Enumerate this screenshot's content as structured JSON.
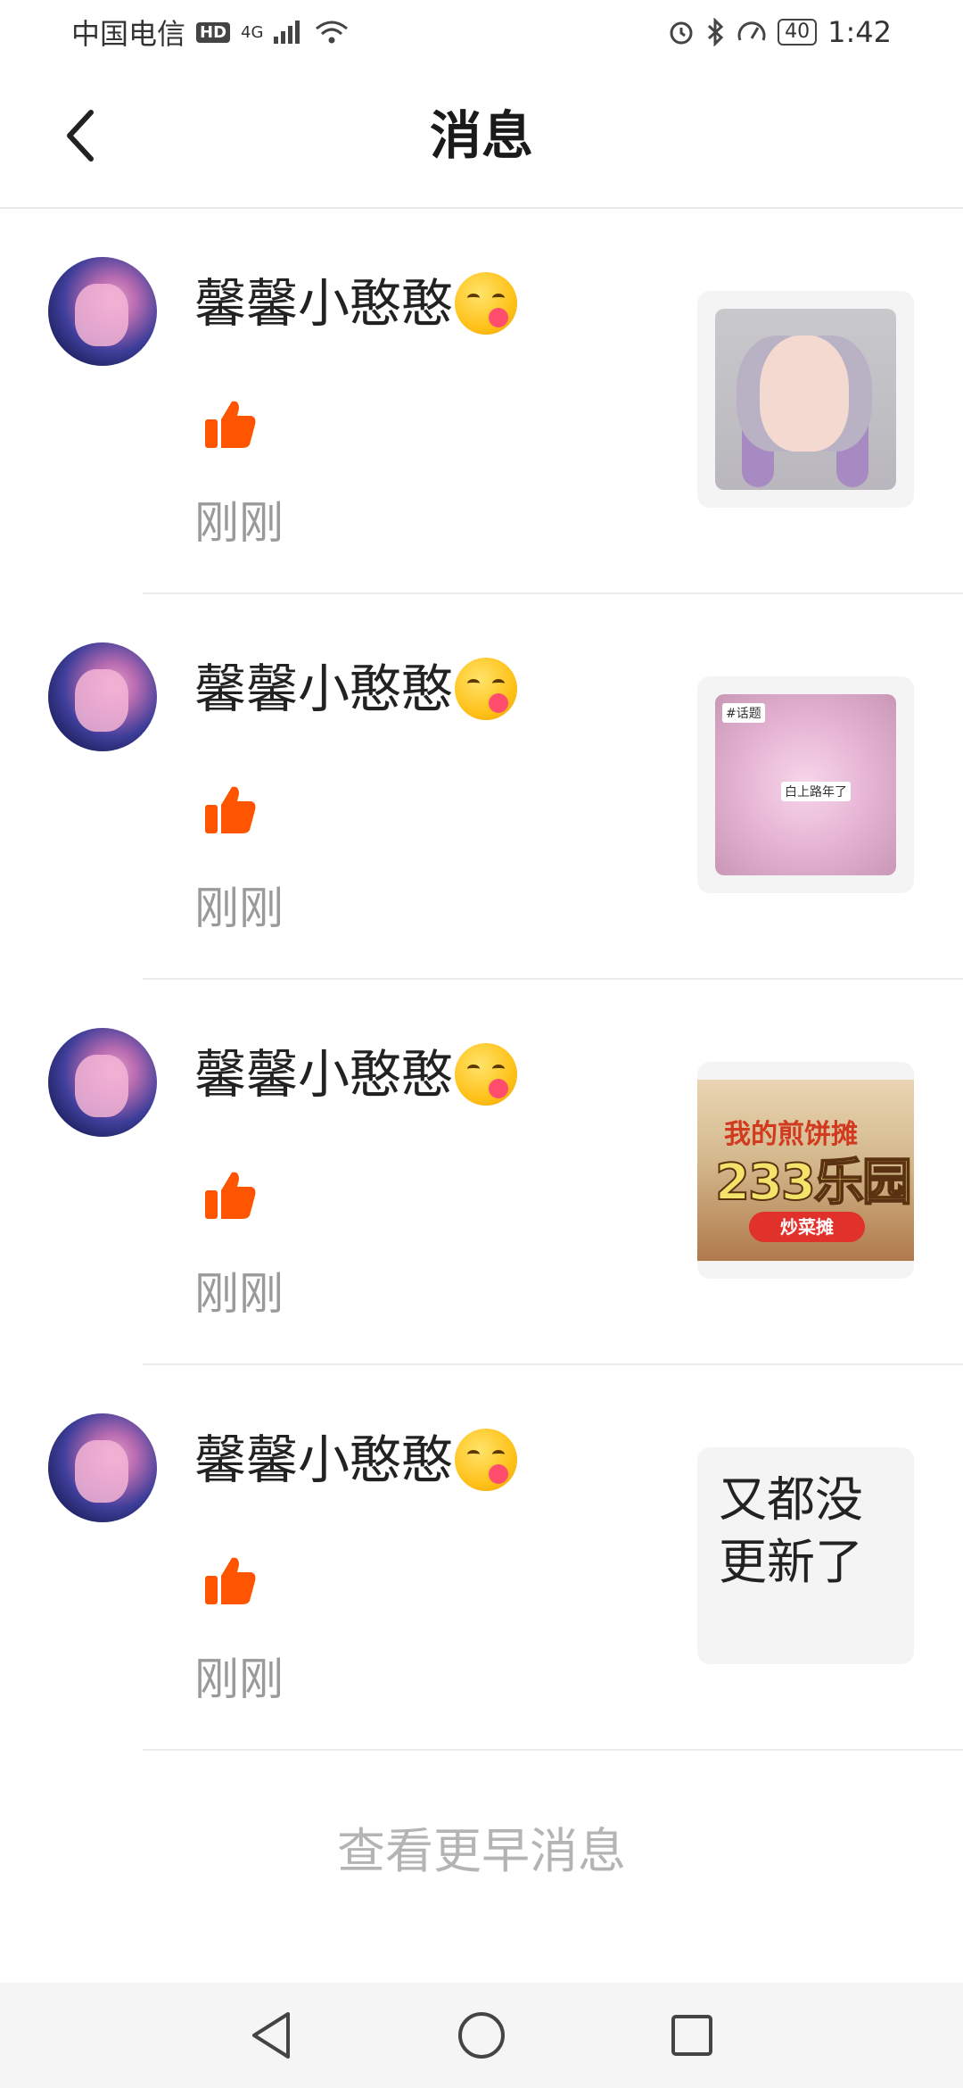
{
  "status_bar": {
    "carrier": "中国电信",
    "hd": "HD",
    "network": "4G",
    "battery": "40",
    "time": "1:42"
  },
  "header": {
    "title": "消息",
    "back_icon": "chevron-left-icon"
  },
  "notifications": [
    {
      "username": "馨馨小憨憨",
      "emoji": "yum-face-emoji",
      "action_icon": "thumbs-up-icon",
      "time": "刚刚",
      "thumbnail": {
        "kind": "image",
        "description_icon": "anime-character-image"
      }
    },
    {
      "username": "馨馨小憨憨",
      "emoji": "yum-face-emoji",
      "action_icon": "thumbs-up-icon",
      "time": "刚刚",
      "thumbnail": {
        "kind": "image",
        "tag": "#话题",
        "caption": "白上路年了"
      }
    },
    {
      "username": "馨馨小憨憨",
      "emoji": "yum-face-emoji",
      "action_icon": "thumbs-up-icon",
      "time": "刚刚",
      "thumbnail": {
        "kind": "image",
        "title": "我的煎饼摊",
        "big": "233乐园",
        "button": "炒菜摊"
      }
    },
    {
      "username": "馨馨小憨憨",
      "emoji": "yum-face-emoji",
      "action_icon": "thumbs-up-icon",
      "time": "刚刚",
      "thumbnail": {
        "kind": "text",
        "text": "又都没更新了"
      }
    }
  ],
  "footer": {
    "more_label": "查看更早消息"
  },
  "nav_bar": {
    "back": "nav-back-icon",
    "home": "nav-home-icon",
    "recents": "nav-recents-icon"
  },
  "colors": {
    "accent": "#ff5500",
    "time_text": "#9a9a9a",
    "more_text": "#b4b4b4"
  }
}
